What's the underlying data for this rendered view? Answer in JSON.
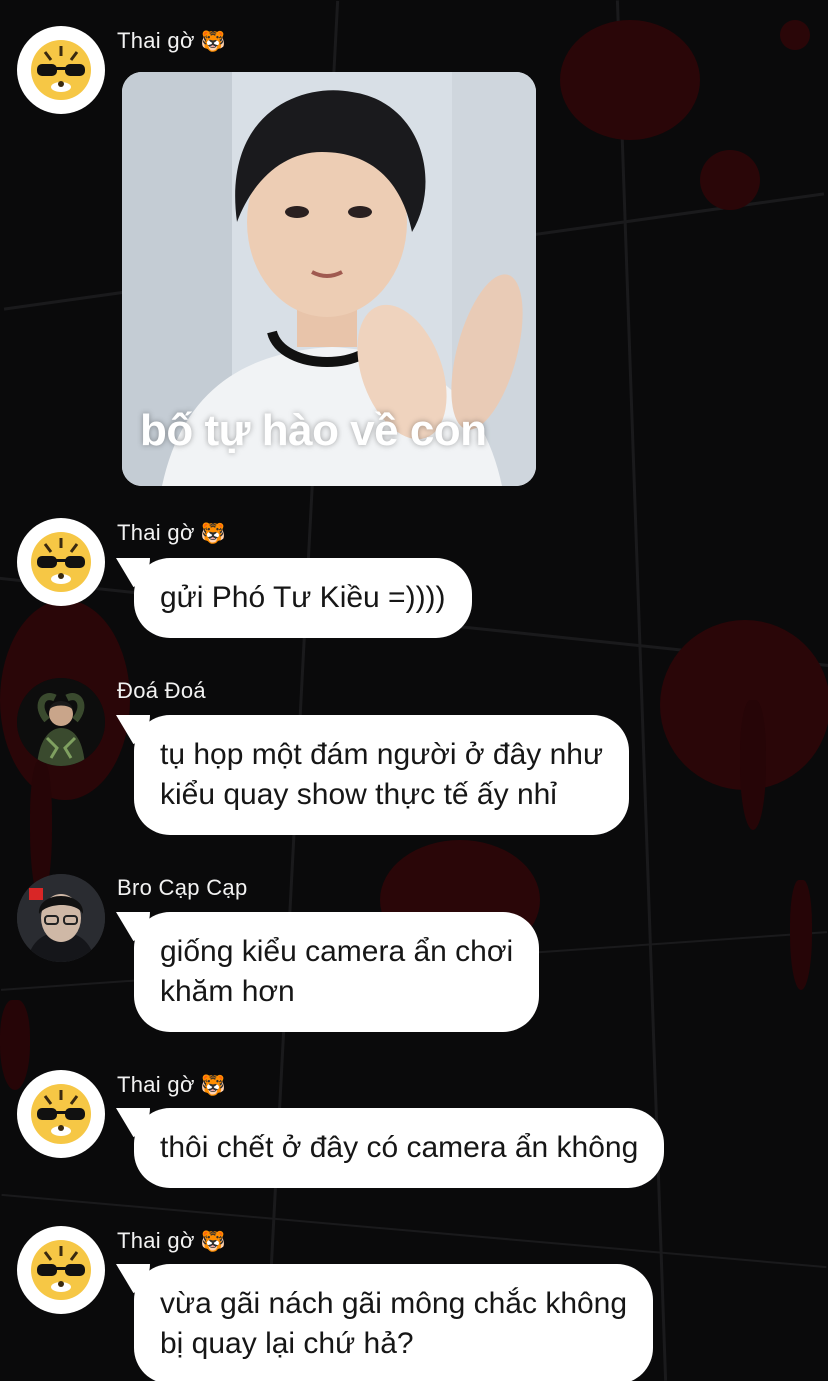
{
  "colors": {
    "background": "#0a0a0b",
    "bubble": "#ffffff",
    "bubble_text": "#161616",
    "sender_text": "#f2f2f2",
    "blood_accent": "#2a0608"
  },
  "messages": [
    {
      "sender": "Thai gờ",
      "sender_emoji": "🐯",
      "avatar_icon": "tiger-sunglasses-icon",
      "type": "image",
      "image_caption": "bố tự hào về con"
    },
    {
      "sender": "Thai gờ",
      "sender_emoji": "🐯",
      "avatar_icon": "tiger-sunglasses-icon",
      "type": "text",
      "lines": [
        "gửi Phó Tư Kiều =))))"
      ]
    },
    {
      "sender": "Đoá Đoá",
      "avatar_icon": "person-photo-avatar",
      "type": "text",
      "lines": [
        "tụ họp một đám người ở đây như",
        "kiểu quay show thực tế ấy nhỉ"
      ]
    },
    {
      "sender": "Bro Cạp Cạp",
      "avatar_icon": "person-glasses-avatar",
      "type": "text",
      "lines": [
        "giống kiểu camera ẩn chơi",
        "khăm hơn"
      ]
    },
    {
      "sender": "Thai gờ",
      "sender_emoji": "🐯",
      "avatar_icon": "tiger-sunglasses-icon",
      "type": "text",
      "lines": [
        "thôi chết ở đây có camera ẩn không"
      ]
    },
    {
      "sender": "Thai gờ",
      "sender_emoji": "🐯",
      "avatar_icon": "tiger-sunglasses-icon",
      "type": "text",
      "lines": [
        "vừa gãi nách gãi mông chắc không",
        "bị quay lại chứ hả?"
      ]
    }
  ]
}
